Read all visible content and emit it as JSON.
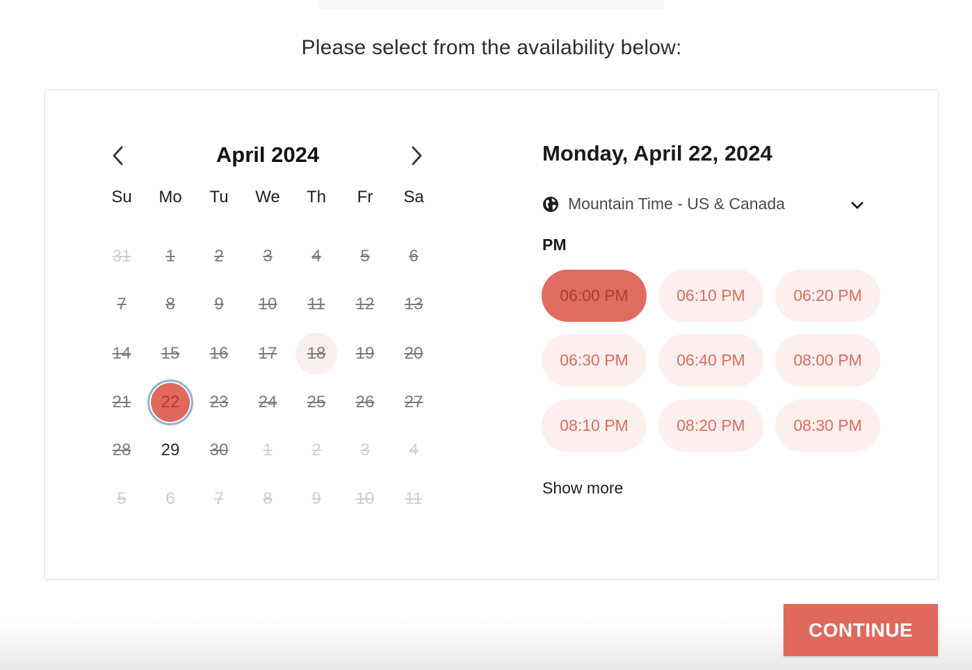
{
  "prompt": "Please select from the availability below:",
  "calendar": {
    "month_title": "April 2024",
    "prev_icon": "chevron-left-icon",
    "next_icon": "chevron-right-icon",
    "weekdays": [
      "Su",
      "Mo",
      "Tu",
      "We",
      "Th",
      "Fr",
      "Sa"
    ],
    "weeks": [
      [
        {
          "label": "31",
          "state": "disabled-other"
        },
        {
          "label": "1",
          "state": "disabled"
        },
        {
          "label": "2",
          "state": "disabled"
        },
        {
          "label": "3",
          "state": "disabled"
        },
        {
          "label": "4",
          "state": "disabled"
        },
        {
          "label": "5",
          "state": "disabled"
        },
        {
          "label": "6",
          "state": "disabled"
        }
      ],
      [
        {
          "label": "7",
          "state": "disabled"
        },
        {
          "label": "8",
          "state": "disabled"
        },
        {
          "label": "9",
          "state": "disabled"
        },
        {
          "label": "10",
          "state": "disabled"
        },
        {
          "label": "11",
          "state": "disabled"
        },
        {
          "label": "12",
          "state": "disabled"
        },
        {
          "label": "13",
          "state": "disabled"
        }
      ],
      [
        {
          "label": "14",
          "state": "disabled"
        },
        {
          "label": "15",
          "state": "disabled"
        },
        {
          "label": "16",
          "state": "disabled"
        },
        {
          "label": "17",
          "state": "disabled"
        },
        {
          "label": "18",
          "state": "today-disabled"
        },
        {
          "label": "19",
          "state": "disabled"
        },
        {
          "label": "20",
          "state": "disabled"
        }
      ],
      [
        {
          "label": "21",
          "state": "disabled"
        },
        {
          "label": "22",
          "state": "selected"
        },
        {
          "label": "23",
          "state": "disabled"
        },
        {
          "label": "24",
          "state": "disabled"
        },
        {
          "label": "25",
          "state": "disabled"
        },
        {
          "label": "26",
          "state": "disabled"
        },
        {
          "label": "27",
          "state": "disabled"
        }
      ],
      [
        {
          "label": "28",
          "state": "disabled"
        },
        {
          "label": "29",
          "state": "available"
        },
        {
          "label": "30",
          "state": "disabled"
        },
        {
          "label": "1",
          "state": "disabled-other"
        },
        {
          "label": "2",
          "state": "disabled-other"
        },
        {
          "label": "3",
          "state": "disabled-other"
        },
        {
          "label": "4",
          "state": "disabled-other"
        }
      ],
      [
        {
          "label": "5",
          "state": "disabled-other"
        },
        {
          "label": "6",
          "state": "other"
        },
        {
          "label": "7",
          "state": "disabled-other"
        },
        {
          "label": "8",
          "state": "disabled-other"
        },
        {
          "label": "9",
          "state": "disabled-other"
        },
        {
          "label": "10",
          "state": "disabled-other"
        },
        {
          "label": "11",
          "state": "disabled-other"
        }
      ]
    ]
  },
  "selected_date_title": "Monday, April 22, 2024",
  "timezone": {
    "icon": "globe-icon",
    "label": "Mountain Time - US & Canada",
    "dropdown_icon": "chevron-down-icon"
  },
  "period_label": "PM",
  "time_slots": [
    {
      "label": "06:00 PM",
      "selected": true
    },
    {
      "label": "06:10 PM",
      "selected": false
    },
    {
      "label": "06:20 PM",
      "selected": false
    },
    {
      "label": "06:30 PM",
      "selected": false
    },
    {
      "label": "06:40 PM",
      "selected": false
    },
    {
      "label": "08:00 PM",
      "selected": false
    },
    {
      "label": "08:10 PM",
      "selected": false
    },
    {
      "label": "08:20 PM",
      "selected": false
    },
    {
      "label": "08:30 PM",
      "selected": false
    }
  ],
  "show_more_label": "Show more",
  "continue_label": "CONTINUE",
  "colors": {
    "accent": "#e0685d",
    "slot_bg": "#fcefed",
    "slot_text": "#de6a5e",
    "selected_ring": "#8fb2de"
  }
}
